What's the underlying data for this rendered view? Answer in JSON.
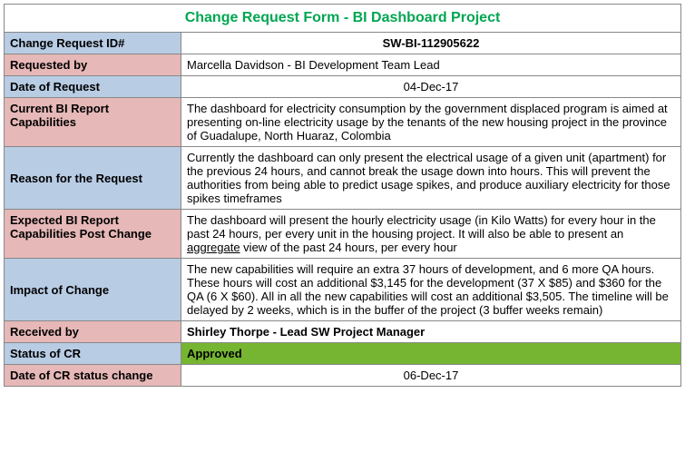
{
  "form": {
    "title": "Change Request Form - BI Dashboard Project",
    "rows": {
      "cr_id": {
        "label": "Change Request ID#",
        "value": "SW-BI-112905622"
      },
      "requested_by": {
        "label": "Requested by",
        "value": "Marcella Davidson - BI Development Team Lead"
      },
      "date_of_request": {
        "label": "Date of Request",
        "value": "04-Dec-17"
      },
      "current_caps": {
        "label": "Current BI Report Capabilities",
        "value": "The dashboard for electricity consumption by the government displaced program is aimed at presenting on-line electricity usage by the tenants of the new housing project in the province of Guadalupe, North Huaraz, Colombia"
      },
      "reason": {
        "label": "Reason for the Request",
        "value": "Currently the dashboard can only present the electrical usage of a given unit (apartment) for the previous 24 hours, and cannot break the usage down into hours. This will prevent the authorities from being able to predict usage spikes, and produce auxiliary electricity for those spikes timeframes"
      },
      "expected_caps": {
        "label": "Expected BI Report Capabilities Post Change",
        "value_pre": "The dashboard will present the hourly electricity usage (in Kilo Watts) for every hour in the past 24 hours, per every unit in the housing project. It will also be able to present an ",
        "value_underlined": "aggregate",
        "value_post": " view of the past 24 hours, per every hour"
      },
      "impact": {
        "label": "Impact of Change",
        "value": "The new capabilities will require an extra 37 hours of development, and 6 more QA hours. These hours will cost an additional $3,145 for the development (37 X $85) and $360 for the QA (6 X $60). All in all the new capabilities will cost an additional $3,505. The timeline will be delayed by 2 weeks, which is in the buffer of the project (3 buffer weeks remain)"
      },
      "received_by": {
        "label": "Received by",
        "value": "Shirley Thorpe - Lead SW Project Manager"
      },
      "status": {
        "label": "Status of CR",
        "value": "Approved"
      },
      "status_date": {
        "label": "Date of CR status change",
        "value": "06-Dec-17"
      }
    }
  }
}
